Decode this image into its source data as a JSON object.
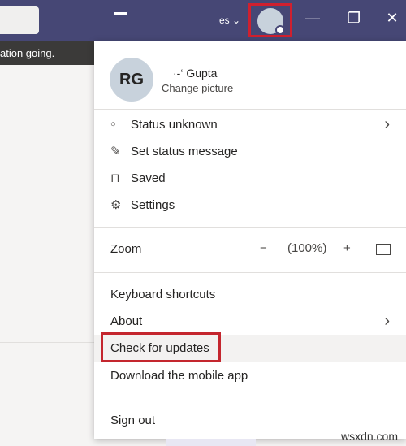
{
  "titlebar": {
    "org_label": "es ⌄",
    "minimize": "—",
    "maximize": "❐",
    "close": "✕",
    "accent": "#464775",
    "highlight": "#d0202f"
  },
  "banner": {
    "text": "ation going."
  },
  "profile": {
    "initials": "RG",
    "name": "·‐‘ Gupta",
    "change_picture": "Change picture"
  },
  "menu": {
    "status": "Status unknown",
    "set_status": "Set status message",
    "saved": "Saved",
    "settings": "Settings",
    "zoom": {
      "label": "Zoom",
      "minus": "−",
      "value": "(100%)",
      "plus": "+",
      "fullscreen_icon": "fit-screen-icon"
    },
    "keyboard_shortcuts": "Keyboard shortcuts",
    "about": "About",
    "check_updates": "Check for updates",
    "download_mobile": "Download the mobile app",
    "sign_out": "Sign out"
  },
  "watermark": "wsxdn.com"
}
